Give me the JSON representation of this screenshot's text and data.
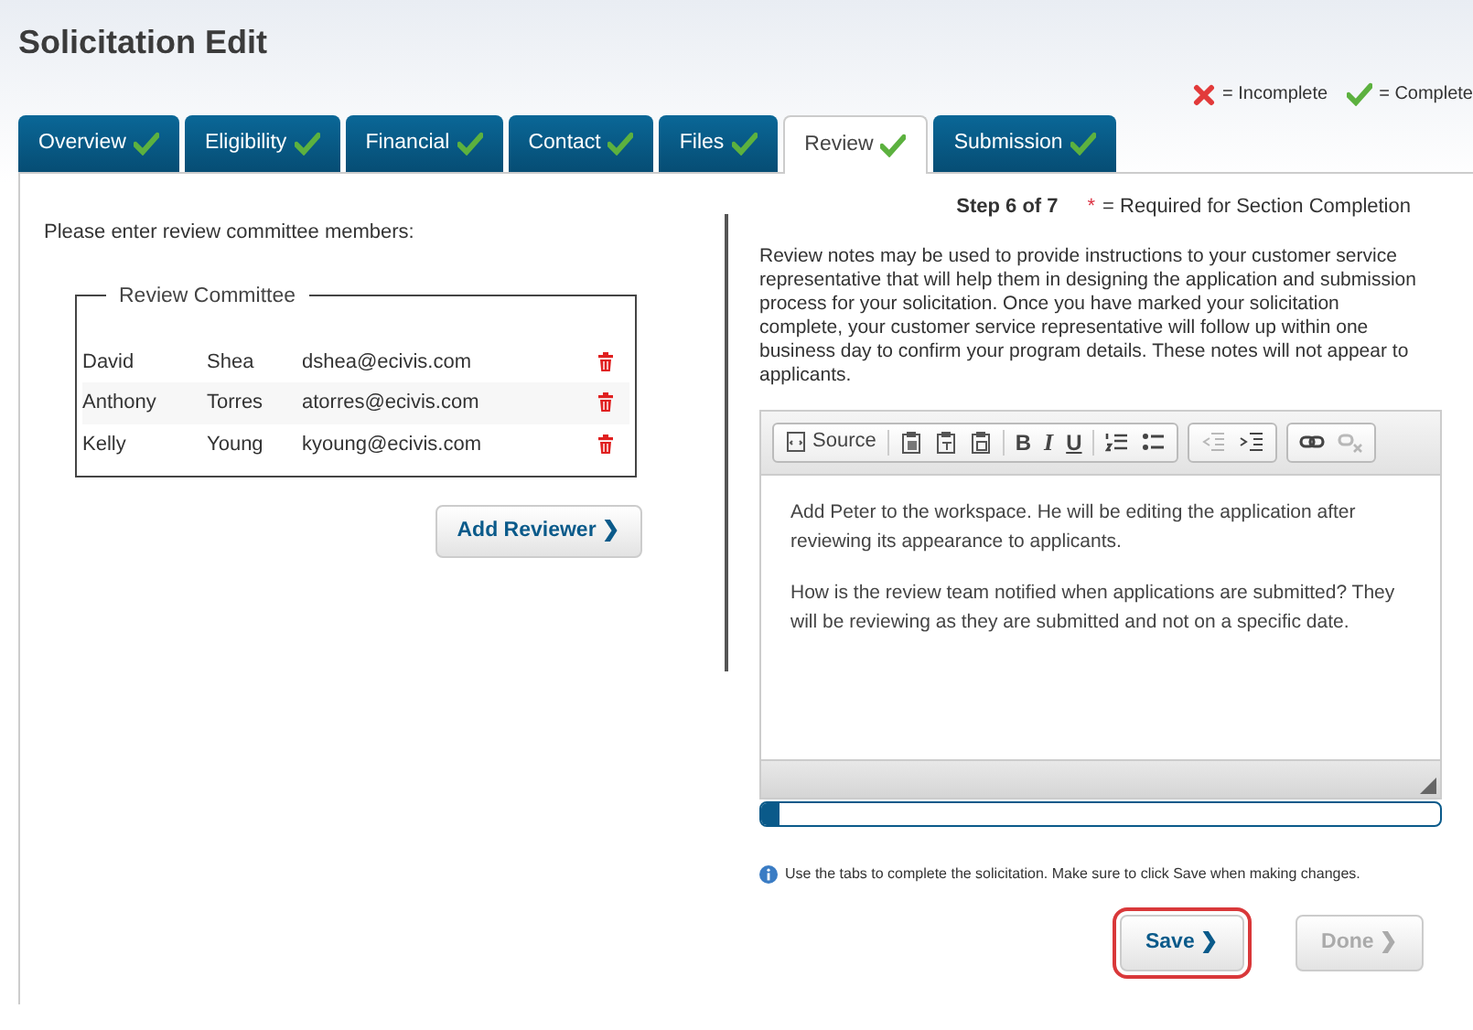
{
  "title": "Solicitation Edit",
  "legend": [
    {
      "kind": "incomplete",
      "label": "= Incomplete"
    },
    {
      "kind": "complete",
      "label": "= Complete"
    }
  ],
  "tabs": [
    {
      "label": "Overview",
      "complete": true,
      "selected": false
    },
    {
      "label": "Eligibility",
      "complete": true,
      "selected": false
    },
    {
      "label": "Financial",
      "complete": true,
      "selected": false
    },
    {
      "label": "Contact",
      "complete": true,
      "selected": false
    },
    {
      "label": "Files",
      "complete": true,
      "selected": false
    },
    {
      "label": "Review",
      "complete": true,
      "selected": true
    },
    {
      "label": "Submission",
      "complete": true,
      "selected": false
    }
  ],
  "instruction": "Please enter review committee members:",
  "committee": {
    "legend": "Review Committee",
    "members": [
      {
        "first": "David",
        "last": "Shea",
        "email": "dshea@ecivis.com"
      },
      {
        "first": "Anthony",
        "last": "Torres",
        "email": "atorres@ecivis.com"
      },
      {
        "first": "Kelly",
        "last": "Young",
        "email": "kyoung@ecivis.com"
      }
    ]
  },
  "add_button": "Add Reviewer ❯",
  "step": "Step 6 of 7",
  "required_mark": "*",
  "required_note": "= Required for Section Completion",
  "notes_intro": "Review notes may be used to provide instructions to your customer service representative that will help them in designing the application and submission process for your solicitation. Once you have marked your solicitation complete, your customer service representative will follow up within one business day to confirm your program details. These notes will not appear to applicants.",
  "editor": {
    "toolbar": [
      {
        "sections": [
          [
            {
              "kind": "source",
              "label": "Source",
              "disabled": false
            }
          ],
          [
            {
              "kind": "paste",
              "disabled": false
            },
            {
              "kind": "paste-text",
              "disabled": false
            },
            {
              "kind": "paste-word",
              "disabled": false
            }
          ],
          [
            {
              "kind": "bold",
              "label": "B",
              "disabled": false
            },
            {
              "kind": "italic",
              "label": "I",
              "disabled": false
            },
            {
              "kind": "underline",
              "label": "U",
              "disabled": false
            }
          ],
          [
            {
              "kind": "numbered-list",
              "disabled": false
            },
            {
              "kind": "bulleted-list",
              "disabled": false
            }
          ]
        ]
      },
      {
        "sections": [
          [
            {
              "kind": "outdent",
              "disabled": true
            },
            {
              "kind": "indent",
              "disabled": false
            }
          ]
        ]
      },
      {
        "sections": [
          [
            {
              "kind": "link",
              "disabled": false
            },
            {
              "kind": "unlink",
              "disabled": true
            }
          ]
        ]
      }
    ],
    "paragraphs": [
      "Add Peter to the workspace. He will be editing the application after reviewing its appearance to applicants.",
      "How is the review team notified when applications are submitted? They will be reviewing as they are submitted and not on a specific date."
    ],
    "progress": {
      "level": 0.01
    }
  },
  "hint": "Use the tabs to complete the solicitation. Make sure to click Save when making changes.",
  "buttons": [
    {
      "label": "Save ❯",
      "highlighted": true,
      "disabled": false
    },
    {
      "label": "Done ❯",
      "highlighted": false,
      "disabled": true
    }
  ]
}
